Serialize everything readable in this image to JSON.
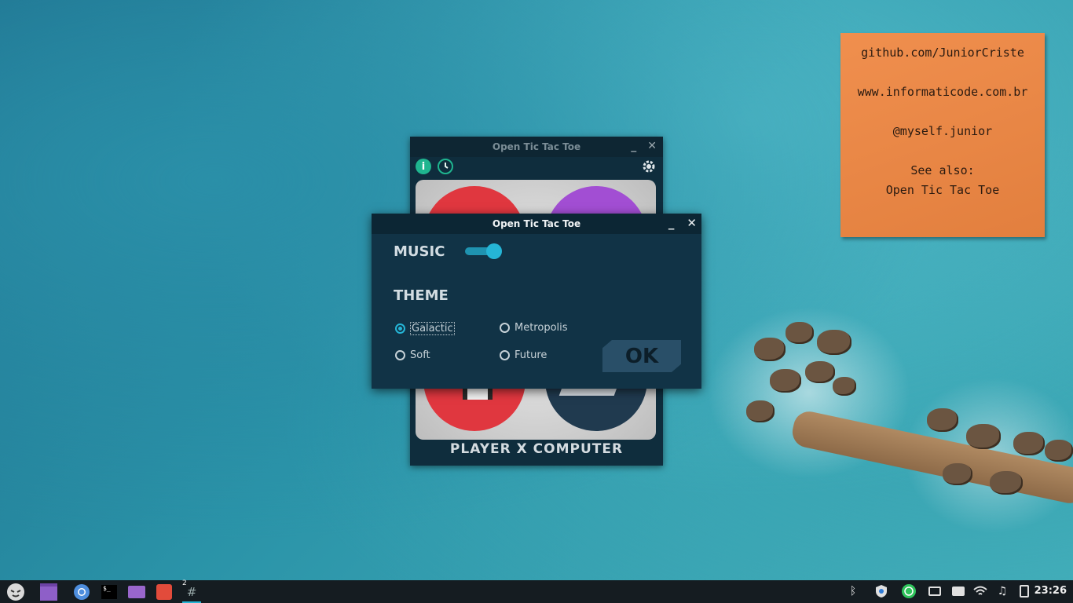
{
  "note": {
    "lines": [
      "github.com/JuniorCriste",
      "www.informaticode.com.br",
      "@myself.junior",
      "See also:",
      "Open Tic Tac Toe"
    ]
  },
  "back_window": {
    "title": "Open Tic Tac Toe",
    "minimize": "_",
    "close": "✕",
    "footer": "PLAYER   X   COMPUTER"
  },
  "dialog": {
    "title": "Open Tic Tac Toe",
    "minimize": "_",
    "close": "✕",
    "music_label": "MUSIC",
    "music_on": true,
    "theme_label": "THEME",
    "themes": [
      {
        "label": "Galactic",
        "selected": true
      },
      {
        "label": "Metropolis",
        "selected": false
      },
      {
        "label": "Soft",
        "selected": false
      },
      {
        "label": "Future",
        "selected": false
      }
    ],
    "ok_label": "OK"
  },
  "taskbar": {
    "workspace_badge": "2",
    "clock": "23:26",
    "apps": [
      "menu-icon",
      "window-icon",
      "chromium-icon",
      "terminal-icon",
      "files-icon",
      "editor-icon",
      "workspace-icon"
    ],
    "tray": [
      "bluetooth-icon",
      "shield-icon",
      "whatsapp-icon",
      "screenshot-icon",
      "printer-icon",
      "wifi-icon",
      "music-icon",
      "battery-icon"
    ]
  },
  "colors": {
    "accent": "#25b5d6",
    "dialog_bg": "#113346",
    "note_bg": "#f08f4e"
  }
}
